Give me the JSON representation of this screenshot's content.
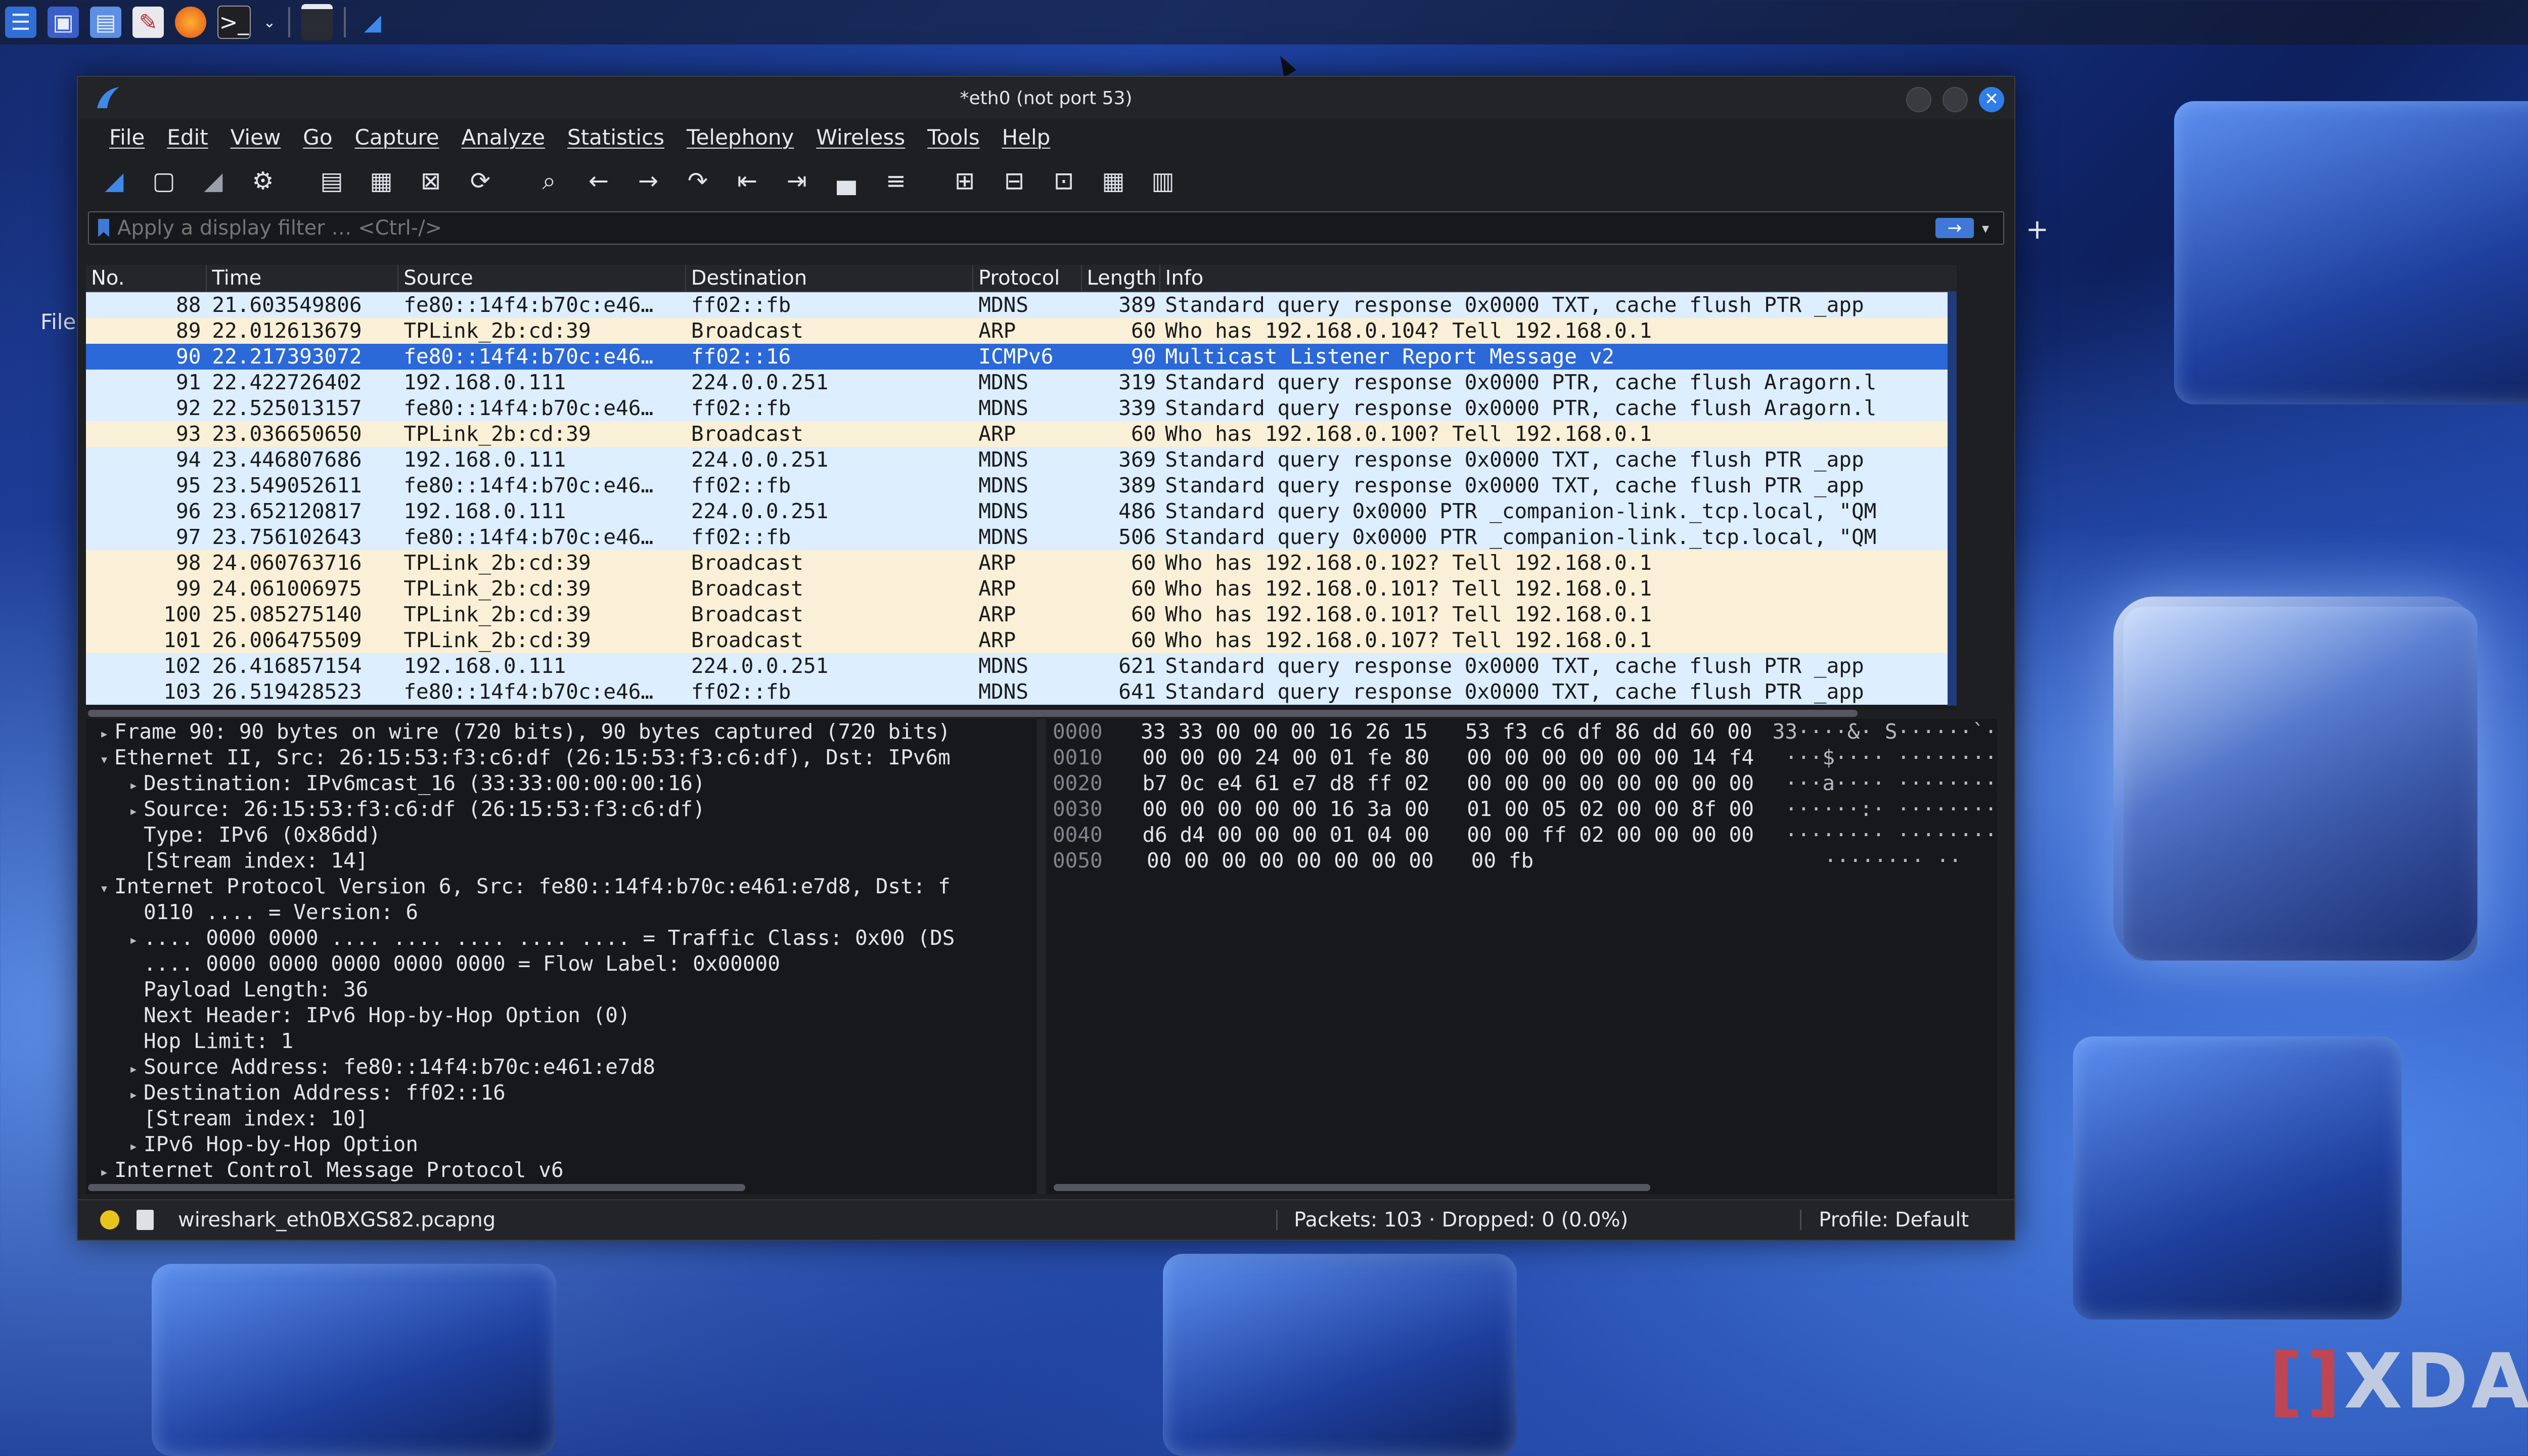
{
  "desktop": {
    "file_label": "File",
    "watermark": "XDA"
  },
  "taskbar": {
    "icons": [
      "kde-menu-icon",
      "desktop-icon",
      "file-manager-icon",
      "text-editor-icon",
      "firefox-icon",
      "terminal-icon",
      "chevron-down-icon",
      "window-icon",
      "wireshark-icon"
    ]
  },
  "window": {
    "title": "*eth0 (not port 53)",
    "menu": [
      "File",
      "Edit",
      "View",
      "Go",
      "Capture",
      "Analyze",
      "Statistics",
      "Telephony",
      "Wireless",
      "Tools",
      "Help"
    ],
    "filter": {
      "placeholder": "Apply a display filter … <Ctrl-/>",
      "apply": "→",
      "add": "+"
    }
  },
  "packet_list": {
    "columns": [
      "No.",
      "Time",
      "Source",
      "Destination",
      "Protocol",
      "Length",
      "Info"
    ],
    "rows": [
      {
        "no": "88",
        "time": "21.603549806",
        "src": "fe80::14f4:b70c:e46…",
        "dst": "ff02::fb",
        "proto": "MDNS",
        "len": "389",
        "info": "Standard query response 0x0000 TXT, cache flush PTR _app",
        "kind": "udp"
      },
      {
        "no": "89",
        "time": "22.012613679",
        "src": "TPLink_2b:cd:39",
        "dst": "Broadcast",
        "proto": "ARP",
        "len": "60",
        "info": "Who has 192.168.0.104? Tell 192.168.0.1",
        "kind": "arp"
      },
      {
        "no": "90",
        "time": "22.217393072",
        "src": "fe80::14f4:b70c:e46…",
        "dst": "ff02::16",
        "proto": "ICMPv6",
        "len": "90",
        "info": "Multicast Listener Report Message v2",
        "kind": "sel"
      },
      {
        "no": "91",
        "time": "22.422726402",
        "src": "192.168.0.111",
        "dst": "224.0.0.251",
        "proto": "MDNS",
        "len": "319",
        "info": "Standard query response 0x0000 PTR, cache flush Aragorn.l",
        "kind": "udp"
      },
      {
        "no": "92",
        "time": "22.525013157",
        "src": "fe80::14f4:b70c:e46…",
        "dst": "ff02::fb",
        "proto": "MDNS",
        "len": "339",
        "info": "Standard query response 0x0000 PTR, cache flush Aragorn.l",
        "kind": "udp"
      },
      {
        "no": "93",
        "time": "23.036650650",
        "src": "TPLink_2b:cd:39",
        "dst": "Broadcast",
        "proto": "ARP",
        "len": "60",
        "info": "Who has 192.168.0.100? Tell 192.168.0.1",
        "kind": "arp"
      },
      {
        "no": "94",
        "time": "23.446807686",
        "src": "192.168.0.111",
        "dst": "224.0.0.251",
        "proto": "MDNS",
        "len": "369",
        "info": "Standard query response 0x0000 TXT, cache flush PTR _app",
        "kind": "udp"
      },
      {
        "no": "95",
        "time": "23.549052611",
        "src": "fe80::14f4:b70c:e46…",
        "dst": "ff02::fb",
        "proto": "MDNS",
        "len": "389",
        "info": "Standard query response 0x0000 TXT, cache flush PTR _app",
        "kind": "udp"
      },
      {
        "no": "96",
        "time": "23.652120817",
        "src": "192.168.0.111",
        "dst": "224.0.0.251",
        "proto": "MDNS",
        "len": "486",
        "info": "Standard query 0x0000 PTR _companion-link._tcp.local, \"QM",
        "kind": "udp"
      },
      {
        "no": "97",
        "time": "23.756102643",
        "src": "fe80::14f4:b70c:e46…",
        "dst": "ff02::fb",
        "proto": "MDNS",
        "len": "506",
        "info": "Standard query 0x0000 PTR _companion-link._tcp.local, \"QM",
        "kind": "udp"
      },
      {
        "no": "98",
        "time": "24.060763716",
        "src": "TPLink_2b:cd:39",
        "dst": "Broadcast",
        "proto": "ARP",
        "len": "60",
        "info": "Who has 192.168.0.102? Tell 192.168.0.1",
        "kind": "arp"
      },
      {
        "no": "99",
        "time": "24.061006975",
        "src": "TPLink_2b:cd:39",
        "dst": "Broadcast",
        "proto": "ARP",
        "len": "60",
        "info": "Who has 192.168.0.101? Tell 192.168.0.1",
        "kind": "arp"
      },
      {
        "no": "100",
        "time": "25.085275140",
        "src": "TPLink_2b:cd:39",
        "dst": "Broadcast",
        "proto": "ARP",
        "len": "60",
        "info": "Who has 192.168.0.101? Tell 192.168.0.1",
        "kind": "arp"
      },
      {
        "no": "101",
        "time": "26.006475509",
        "src": "TPLink_2b:cd:39",
        "dst": "Broadcast",
        "proto": "ARP",
        "len": "60",
        "info": "Who has 192.168.0.107? Tell 192.168.0.1",
        "kind": "arp"
      },
      {
        "no": "102",
        "time": "26.416857154",
        "src": "192.168.0.111",
        "dst": "224.0.0.251",
        "proto": "MDNS",
        "len": "621",
        "info": "Standard query response 0x0000 TXT, cache flush PTR _app",
        "kind": "udp"
      },
      {
        "no": "103",
        "time": "26.519428523",
        "src": "fe80::14f4:b70c:e46…",
        "dst": "ff02::fb",
        "proto": "MDNS",
        "len": "641",
        "info": "Standard query response 0x0000 TXT, cache flush PTR _app",
        "kind": "udp"
      }
    ]
  },
  "details": {
    "rows": [
      {
        "level": 0,
        "toggle": "▸",
        "text": "Frame 90: 90 bytes on wire (720 bits), 90 bytes captured (720 bits)"
      },
      {
        "level": 0,
        "toggle": "▾",
        "text": "Ethernet II, Src: 26:15:53:f3:c6:df (26:15:53:f3:c6:df), Dst: IPv6m"
      },
      {
        "level": 1,
        "toggle": "▸",
        "text": "Destination: IPv6mcast_16 (33:33:00:00:00:16)"
      },
      {
        "level": 1,
        "toggle": "▸",
        "text": "Source: 26:15:53:f3:c6:df (26:15:53:f3:c6:df)"
      },
      {
        "level": 1,
        "toggle": "",
        "text": "Type: IPv6 (0x86dd)"
      },
      {
        "level": 1,
        "toggle": "",
        "text": "[Stream index: 14]"
      },
      {
        "level": 0,
        "toggle": "▾",
        "text": "Internet Protocol Version 6, Src: fe80::14f4:b70c:e461:e7d8, Dst: f"
      },
      {
        "level": 1,
        "toggle": "",
        "text": "0110 .... = Version: 6"
      },
      {
        "level": 1,
        "toggle": "▸",
        "text": ".... 0000 0000 .... .... .... .... .... = Traffic Class: 0x00 (DS"
      },
      {
        "level": 1,
        "toggle": "",
        "text": ".... 0000 0000 0000 0000 0000 = Flow Label: 0x00000"
      },
      {
        "level": 1,
        "toggle": "",
        "text": "Payload Length: 36"
      },
      {
        "level": 1,
        "toggle": "",
        "text": "Next Header: IPv6 Hop-by-Hop Option (0)"
      },
      {
        "level": 1,
        "toggle": "",
        "text": "Hop Limit: 1"
      },
      {
        "level": 1,
        "toggle": "▸",
        "text": "Source Address: fe80::14f4:b70c:e461:e7d8"
      },
      {
        "level": 1,
        "toggle": "▸",
        "text": "Destination Address: ff02::16"
      },
      {
        "level": 1,
        "toggle": "",
        "text": "[Stream index: 10]"
      },
      {
        "level": 1,
        "toggle": "▸",
        "text": "IPv6 Hop-by-Hop Option"
      },
      {
        "level": 0,
        "toggle": "▸",
        "text": "Internet Control Message Protocol v6"
      }
    ]
  },
  "bytes": {
    "rows": [
      {
        "offset": "0000",
        "hex": "33 33 00 00 00 16 26 15   53 f3 c6 df 86 dd 60 00",
        "ascii": "33····&· S······`·"
      },
      {
        "offset": "0010",
        "hex": "00 00 00 24 00 01 fe 80   00 00 00 00 00 00 14 f4",
        "ascii": "···$···· ········"
      },
      {
        "offset": "0020",
        "hex": "b7 0c e4 61 e7 d8 ff 02   00 00 00 00 00 00 00 00",
        "ascii": "···a···· ········"
      },
      {
        "offset": "0030",
        "hex": "00 00 00 00 00 16 3a 00   01 00 05 02 00 00 8f 00",
        "ascii": "······:· ········"
      },
      {
        "offset": "0040",
        "hex": "d6 d4 00 00 00 01 04 00   00 00 ff 02 00 00 00 00",
        "ascii": "········ ········"
      },
      {
        "offset": "0050",
        "hex": "00 00 00 00 00 00 00 00   00 fb",
        "ascii": "········ ··"
      }
    ]
  },
  "status": {
    "file": "wireshark_eth0BXGS82.pcapng",
    "packets": "Packets: 103 · Dropped: 0 (0.0%)",
    "profile": "Profile: Default"
  },
  "colors": {
    "selected_row": "#2b68d8",
    "udp_row": "#dceeff",
    "arp_row": "#faf0d7",
    "status_led": "#e8c51c"
  }
}
